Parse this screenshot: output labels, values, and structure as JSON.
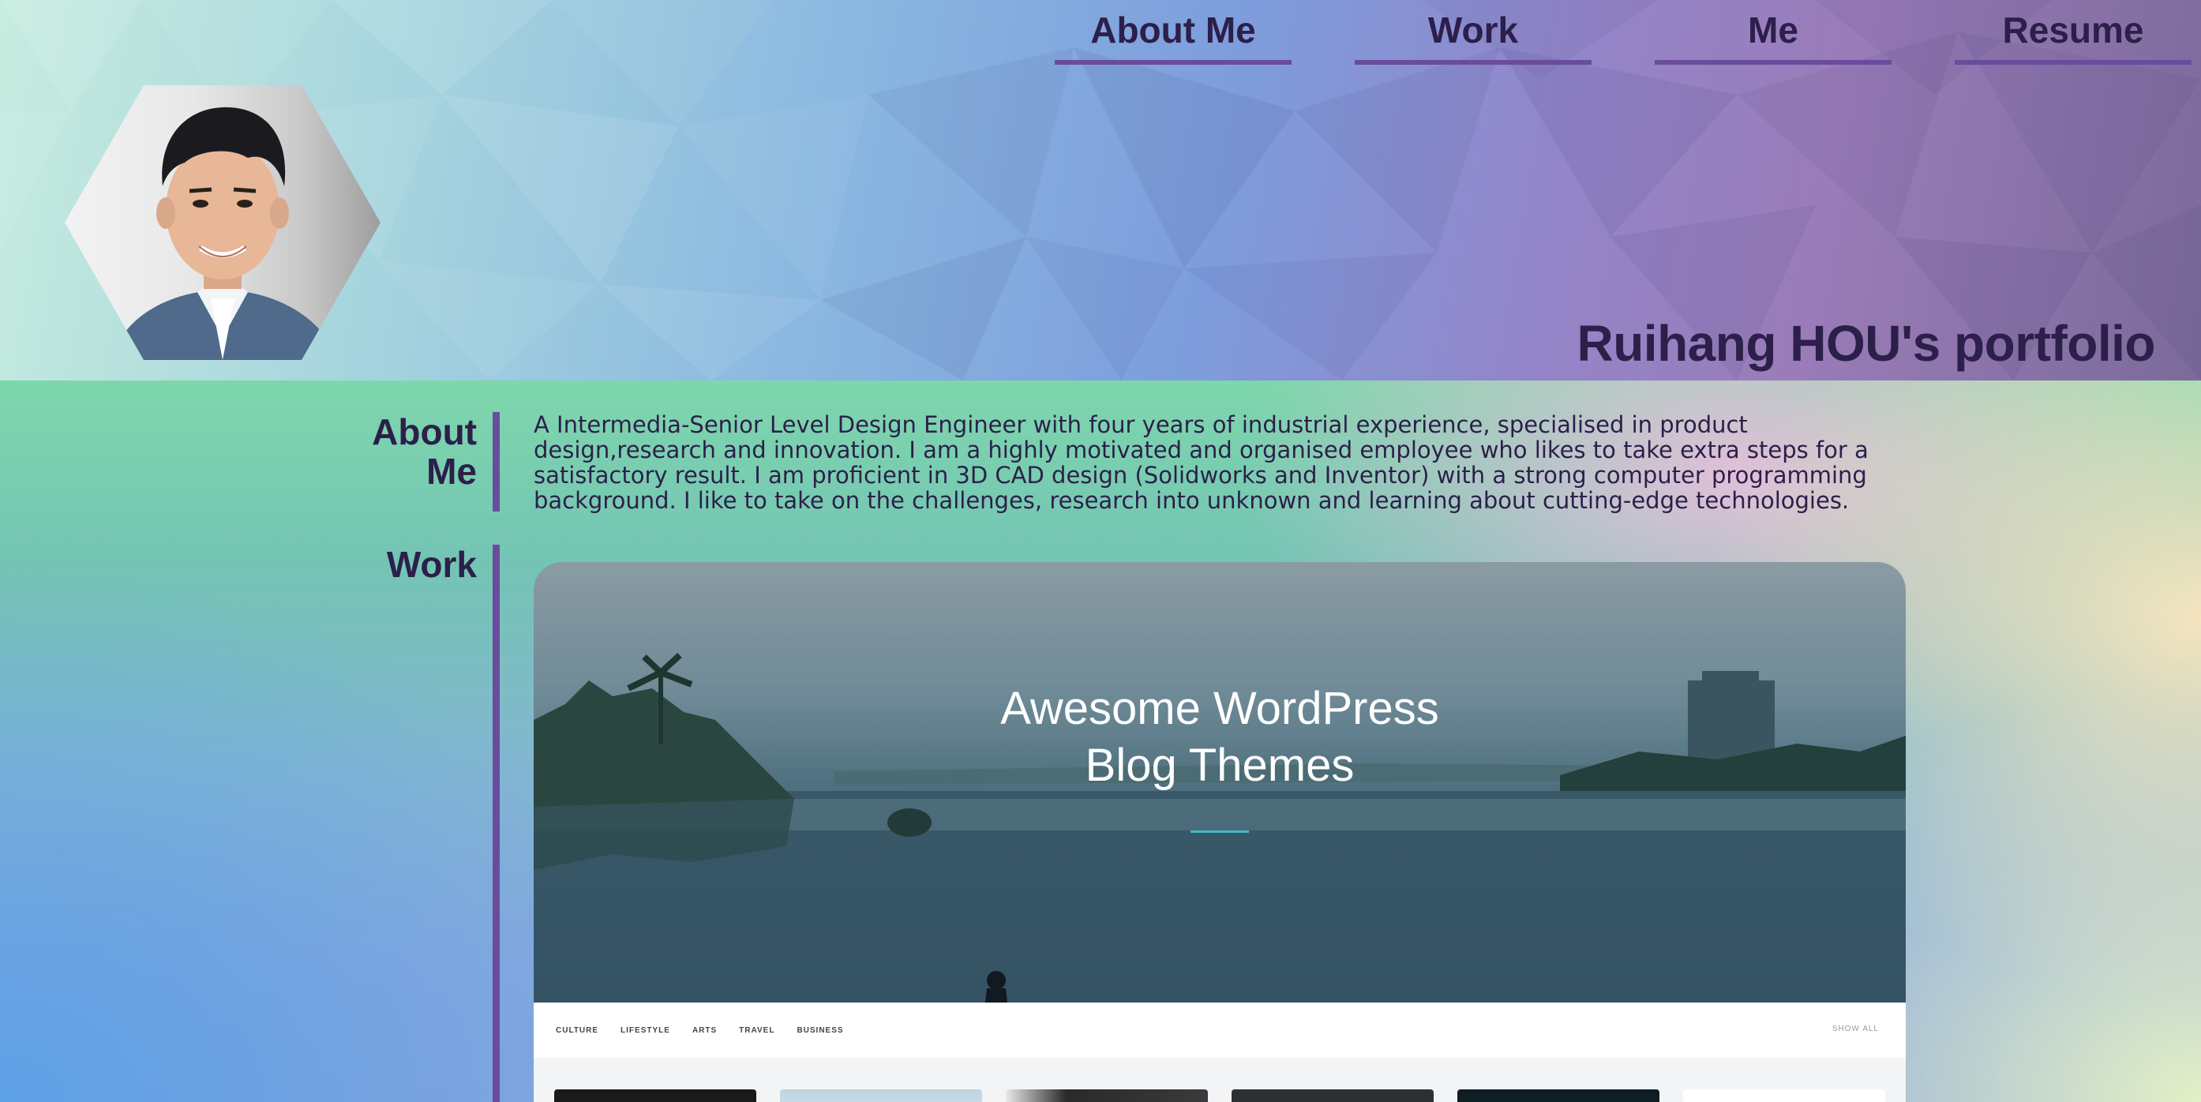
{
  "nav": {
    "items": [
      {
        "label": "About Me"
      },
      {
        "label": "Work"
      },
      {
        "label": "Me"
      },
      {
        "label": "Resume"
      }
    ]
  },
  "header": {
    "title": "Ruihang HOU's portfolio"
  },
  "about": {
    "heading": "About Me",
    "text": "A Intermedia-Senior Level Design Engineer with four years of industrial experience, specialised in product design,research and innovation. I am a highly motivated and organised employee who likes to take extra steps for a satisfactory result. I am proficient in 3D CAD design (Solidworks and Inventor) with a strong computer programming background. I like to take on the challenges, research into unknown and learning about cutting-edge technologies."
  },
  "work": {
    "heading": "Work",
    "card": {
      "title_line1": "Awesome WordPress",
      "title_line2": "Blog Themes",
      "categories": [
        "CULTURE",
        "LIFESTYLE",
        "ARTS",
        "TRAVEL",
        "BUSINESS"
      ],
      "show_all": "SHOW ALL"
    }
  },
  "colors": {
    "text": "#2c1f4a",
    "accent": "#6a4c9c"
  }
}
